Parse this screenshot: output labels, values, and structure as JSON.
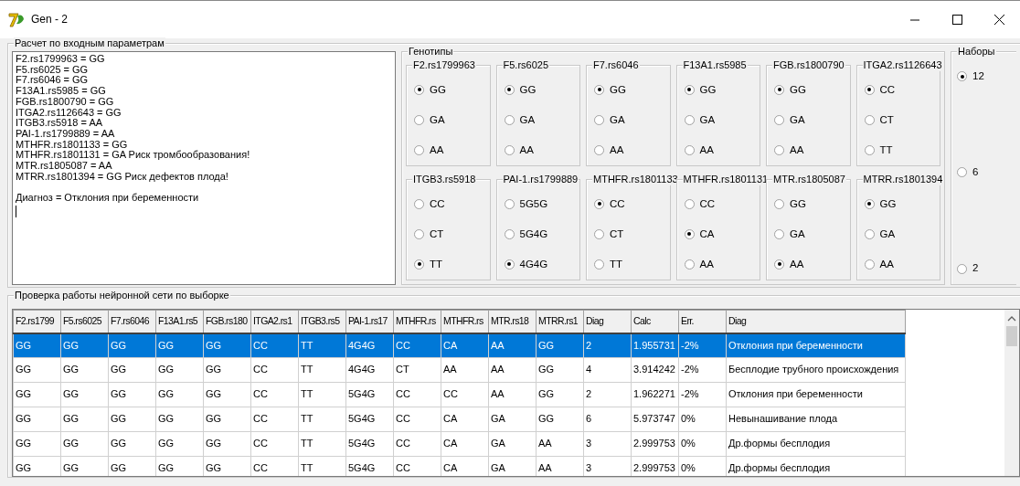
{
  "window": {
    "title": "Gen - 2"
  },
  "input_group": {
    "title": "Расчет по входным параметрам",
    "result_lines": [
      "F2.rs1799963 = GG",
      "F5.rs6025 = GG",
      "F7.rs6046 = GG",
      "F13A1.rs5985 = GG",
      "FGB.rs1800790 = GG",
      "ITGA2.rs1126643 = GG",
      "ITGB3.rs5918 = AA",
      "PAI-1.rs1799889 = AA",
      "MTHFR.rs1801133 = GG",
      "MTHFR.rs1801131 = GA Риск тромбообразования!",
      "MTR.rs1805087 = AA",
      "MTRR.rs1801394 = GG Риск дефектов плода!"
    ],
    "diagnosis": "Диагноз = Отклония при беременности",
    "genotypes": {
      "title": "Генотипы",
      "groups": [
        {
          "label": "F2.rs1799963",
          "options": [
            {
              "label": "GG",
              "selected": true
            },
            {
              "label": "GA",
              "selected": false
            },
            {
              "label": "AA",
              "selected": false
            }
          ]
        },
        {
          "label": "F5.rs6025",
          "options": [
            {
              "label": "GG",
              "selected": true
            },
            {
              "label": "GA",
              "selected": false
            },
            {
              "label": "AA",
              "selected": false
            }
          ]
        },
        {
          "label": "F7.rs6046",
          "options": [
            {
              "label": "GG",
              "selected": true
            },
            {
              "label": "GA",
              "selected": false
            },
            {
              "label": "AA",
              "selected": false
            }
          ]
        },
        {
          "label": "F13A1.rs5985",
          "options": [
            {
              "label": "GG",
              "selected": true
            },
            {
              "label": "GA",
              "selected": false
            },
            {
              "label": "AA",
              "selected": false
            }
          ]
        },
        {
          "label": "FGB.rs1800790",
          "options": [
            {
              "label": "GG",
              "selected": true
            },
            {
              "label": "GA",
              "selected": false
            },
            {
              "label": "AA",
              "selected": false
            }
          ]
        },
        {
          "label": "ITGA2.rs1126643",
          "options": [
            {
              "label": "CC",
              "selected": true
            },
            {
              "label": "CT",
              "selected": false
            },
            {
              "label": "TT",
              "selected": false
            }
          ]
        },
        {
          "label": "ITGB3.rs5918",
          "options": [
            {
              "label": "CC",
              "selected": false
            },
            {
              "label": "CT",
              "selected": false
            },
            {
              "label": "TT",
              "selected": true
            }
          ]
        },
        {
          "label": "PAI-1.rs1799889",
          "options": [
            {
              "label": "5G5G",
              "selected": false
            },
            {
              "label": "5G4G",
              "selected": false
            },
            {
              "label": "4G4G",
              "selected": true
            }
          ]
        },
        {
          "label": "MTHFR.rs1801133",
          "options": [
            {
              "label": "CC",
              "selected": true
            },
            {
              "label": "CT",
              "selected": false
            },
            {
              "label": "TT",
              "selected": false
            }
          ]
        },
        {
          "label": "MTHFR.rs1801131",
          "options": [
            {
              "label": "CC",
              "selected": false
            },
            {
              "label": "CA",
              "selected": true
            },
            {
              "label": "AA",
              "selected": false
            }
          ]
        },
        {
          "label": "MTR.rs1805087",
          "options": [
            {
              "label": "GG",
              "selected": false
            },
            {
              "label": "GA",
              "selected": false
            },
            {
              "label": "AA",
              "selected": true
            }
          ]
        },
        {
          "label": "MTRR.rs1801394",
          "options": [
            {
              "label": "GG",
              "selected": true
            },
            {
              "label": "GA",
              "selected": false
            },
            {
              "label": "AA",
              "selected": false
            }
          ]
        }
      ]
    },
    "sets": {
      "title": "Наборы",
      "options": [
        {
          "label": "12",
          "selected": true
        },
        {
          "label": "6",
          "selected": false
        },
        {
          "label": "2",
          "selected": false
        }
      ]
    }
  },
  "test_group": {
    "title": "Проверка работы нейронной сети по выборке",
    "table": {
      "columns": [
        "F2.rs1799",
        "F5.rs6025",
        "F7.rs6046",
        "F13A1.rs5",
        "FGB.rs180",
        "ITGA2.rs1",
        "ITGB3.rs5",
        "PAI-1.rs17",
        "MTHFR.rs",
        "MTHFR.rs",
        "MTR.rs18",
        "MTRR.rs1",
        "Diag",
        "Calc",
        "Err.",
        "Diag"
      ],
      "rows": [
        {
          "selected": true,
          "cells": [
            "GG",
            "GG",
            "GG",
            "GG",
            "GG",
            "CC",
            "TT",
            "4G4G",
            "CC",
            "CA",
            "AA",
            "GG",
            "2",
            "1.955731",
            "-2%",
            "Отклония при беременности"
          ]
        },
        {
          "selected": false,
          "cells": [
            "GG",
            "GG",
            "GG",
            "GG",
            "GG",
            "CC",
            "TT",
            "4G4G",
            "CT",
            "AA",
            "AA",
            "GG",
            "4",
            "3.914242",
            "-2%",
            "Бесплодие трубного происхождения"
          ]
        },
        {
          "selected": false,
          "cells": [
            "GG",
            "GG",
            "GG",
            "GG",
            "GG",
            "CC",
            "TT",
            "5G4G",
            "CC",
            "CC",
            "AA",
            "GG",
            "2",
            "1.962271",
            "-2%",
            "Отклония при беременности"
          ]
        },
        {
          "selected": false,
          "cells": [
            "GG",
            "GG",
            "GG",
            "GG",
            "GG",
            "CC",
            "TT",
            "5G4G",
            "CC",
            "CA",
            "GA",
            "GG",
            "6",
            "5.973747",
            "0%",
            "Невынашивание плода"
          ]
        },
        {
          "selected": false,
          "cells": [
            "GG",
            "GG",
            "GG",
            "GG",
            "GG",
            "CC",
            "TT",
            "5G4G",
            "CC",
            "CA",
            "GA",
            "AA",
            "3",
            "2.999753",
            "0%",
            "Др.формы бесплодия"
          ]
        },
        {
          "selected": false,
          "cells": [
            "GG",
            "GG",
            "GG",
            "GG",
            "GG",
            "CC",
            "TT",
            "5G4G",
            "CC",
            "CA",
            "GA",
            "AA",
            "3",
            "2.999753",
            "0%",
            "Др.формы бесплодия"
          ]
        }
      ]
    }
  }
}
